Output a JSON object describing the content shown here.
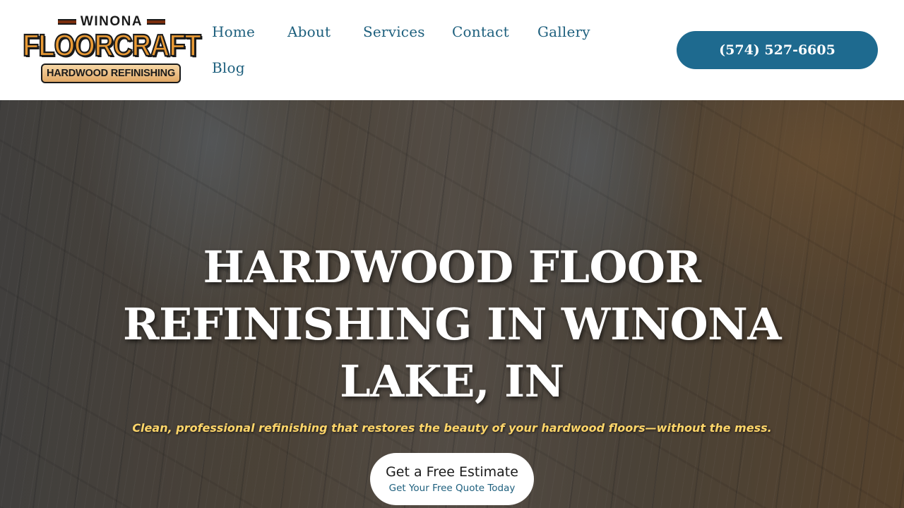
{
  "logo": {
    "top_text": "WINONA",
    "main_text": "FLOORCRAFT",
    "sub_text": "HARDWOOD REFINISHING",
    "colors": {
      "orange": "#e99a35",
      "tan": "#f6d7a6",
      "brown": "#7a2e0e",
      "dark": "#1a1a1a"
    }
  },
  "nav": {
    "items": [
      {
        "label": "Home"
      },
      {
        "label": "About"
      },
      {
        "label": "Services"
      },
      {
        "label": "Contact"
      },
      {
        "label": "Gallery"
      },
      {
        "label": "Blog"
      }
    ],
    "color": "#1d5f7d"
  },
  "header": {
    "phone": "(574) 527-6605",
    "phone_bg": "#1e6a8f"
  },
  "hero": {
    "title": "HARDWOOD FLOOR REFINISHING IN WINONA LAKE, IN",
    "subtitle": "Clean, professional refinishing that restores the beauty of your hardwood floors—without the mess.",
    "subtitle_color": "#ffd66a",
    "cta": {
      "label": "Get a Free Estimate",
      "sublabel": "Get Your Free Quote Today"
    }
  }
}
